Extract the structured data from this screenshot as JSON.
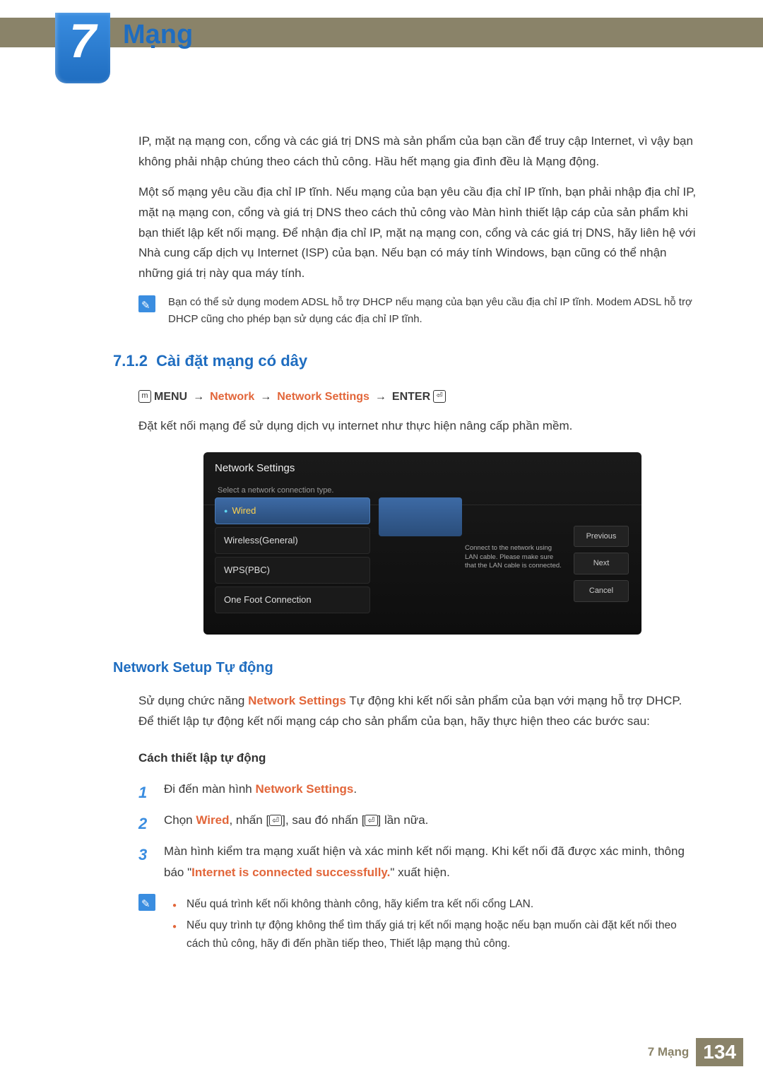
{
  "chapter": {
    "number": "7",
    "title": "Mạng"
  },
  "intro": {
    "p1": "IP, mặt nạ mạng con, cổng và các giá trị DNS mà sản phẩm của bạn cần để truy cập Internet, vì vậy bạn không phải nhập chúng theo cách thủ công. Hầu hết mạng gia đình đều là Mạng động.",
    "p2": "Một số mạng yêu cầu địa chỉ IP tĩnh. Nếu mạng của bạn yêu cầu địa chỉ IP tĩnh, bạn phải nhập địa chỉ IP, mặt nạ mạng con, cổng và giá trị DNS theo cách thủ công vào Màn hình thiết lập cáp của sản phẩm khi bạn thiết lập kết nối mạng. Để nhận địa chỉ IP, mặt nạ mạng con, cổng và các giá trị DNS, hãy liên hệ với Nhà cung cấp dịch vụ Internet (ISP) của bạn. Nếu bạn có máy tính Windows, bạn cũng có thể nhận những giá trị này qua máy tính."
  },
  "note1": "Bạn có thể sử dụng modem ADSL hỗ trợ DHCP nếu mạng của bạn yêu cầu địa chỉ IP tĩnh. Modem ADSL hỗ trợ DHCP cũng cho phép bạn sử dụng các địa chỉ IP tĩnh.",
  "section": {
    "num": "7.1.2",
    "title": "Cài đặt mạng có dây",
    "path": {
      "menu": "MENU",
      "p1": "Network",
      "p2": "Network Settings",
      "enter": "ENTER"
    },
    "desc": "Đặt kết nối mạng để sử dụng dịch vụ internet như thực hiện nâng cấp phần mềm."
  },
  "screenshot": {
    "title": "Network Settings",
    "subtitle": "Select a network connection type.",
    "options": [
      "Wired",
      "Wireless(General)",
      "WPS(PBC)",
      "One Foot Connection"
    ],
    "info": "Connect to the network using LAN cable. Please make sure that the LAN cable is connected.",
    "buttons": [
      "Previous",
      "Next",
      "Cancel"
    ]
  },
  "auto": {
    "heading": "Network Setup Tự động",
    "p_pre": "Sử dụng chức năng ",
    "p_hl": "Network Settings",
    "p_post": " Tự động khi kết nối sản phẩm của bạn với mạng hỗ trợ DHCP. Để thiết lập tự động kết nối mạng cáp cho sản phẩm của bạn, hãy thực hiện theo các bước sau:",
    "sub": "Cách thiết lập tự động",
    "steps": {
      "s1_pre": "Đi đến màn hình ",
      "s1_hl": "Network Settings",
      "s1_post": ".",
      "s2_pre": "Chọn ",
      "s2_hl": "Wired",
      "s2_mid": ", nhấn [",
      "s2_mid2": "], sau đó nhấn [",
      "s2_post": "] lần nữa.",
      "s3_a": "Màn hình kiểm tra mạng xuất hiện và xác minh kết nối mạng. Khi kết nối đã được xác minh, thông báo \"",
      "s3_hl": "Internet is connected successfully.",
      "s3_b": "\" xuất hiện."
    },
    "note_bullets": [
      "Nếu quá trình kết nối không thành công, hãy kiểm tra kết nối cổng LAN.",
      "Nếu quy trình tự động không thể tìm thấy giá trị kết nối mạng hoặc nếu bạn muốn cài đặt kết nối theo cách thủ công, hãy đi đến phần tiếp theo, Thiết lập mạng thủ công."
    ]
  },
  "footer": {
    "label": "7 Mạng",
    "page": "134"
  }
}
